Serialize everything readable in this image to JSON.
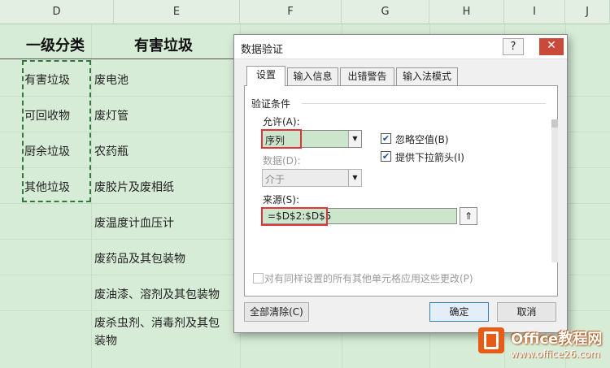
{
  "sheet": {
    "col_headers": [
      "D",
      "E",
      "F",
      "G",
      "H",
      "I",
      "J"
    ],
    "header_d": "一级分类",
    "header_e": "有害垃圾",
    "col_d": [
      "有害垃圾",
      "可回收物",
      "厨余垃圾",
      "其他垃圾"
    ],
    "col_e": [
      "废电池",
      "废灯管",
      "农药瓶",
      "废胶片及废相纸",
      "废温度计血压计",
      "废药品及其包装物",
      "废油漆、溶剂及其包装物",
      "废杀虫剂、消毒剂及其包",
      "装物"
    ]
  },
  "dialog": {
    "title": "数据验证",
    "help_label": "?",
    "close_label": "✕",
    "tabs": [
      "设置",
      "输入信息",
      "出错警告",
      "输入法模式"
    ],
    "group_title": "验证条件",
    "allow_label": "允许(A):",
    "allow_value": "序列",
    "data_label": "数据(D):",
    "data_value": "介于",
    "ignore_blank_label": "忽略空值(B)",
    "ignore_blank_checked": true,
    "dropdown_label": "提供下拉箭头(I)",
    "dropdown_checked": true,
    "source_label": "来源(S):",
    "source_value": "=$D$2:$D$5",
    "apply_all_label": "对有同样设置的所有其他单元格应用这些更改(P)",
    "apply_all_checked": false,
    "clear_all_label": "全部清除(C)",
    "ok_label": "确定",
    "cancel_label": "取消"
  },
  "watermark": {
    "title": "Office教程网",
    "url": "www.office26.com"
  },
  "colors": {
    "sheet_bg": "#d7ecd7",
    "highlight": "#e0343a",
    "marquee": "#2f7a3a",
    "watermark": "#e65c17"
  },
  "icons": {
    "collapse": "collapse-dialog-icon",
    "dropdown": "dropdown-arrow-icon",
    "logo": "office-logo-icon"
  }
}
